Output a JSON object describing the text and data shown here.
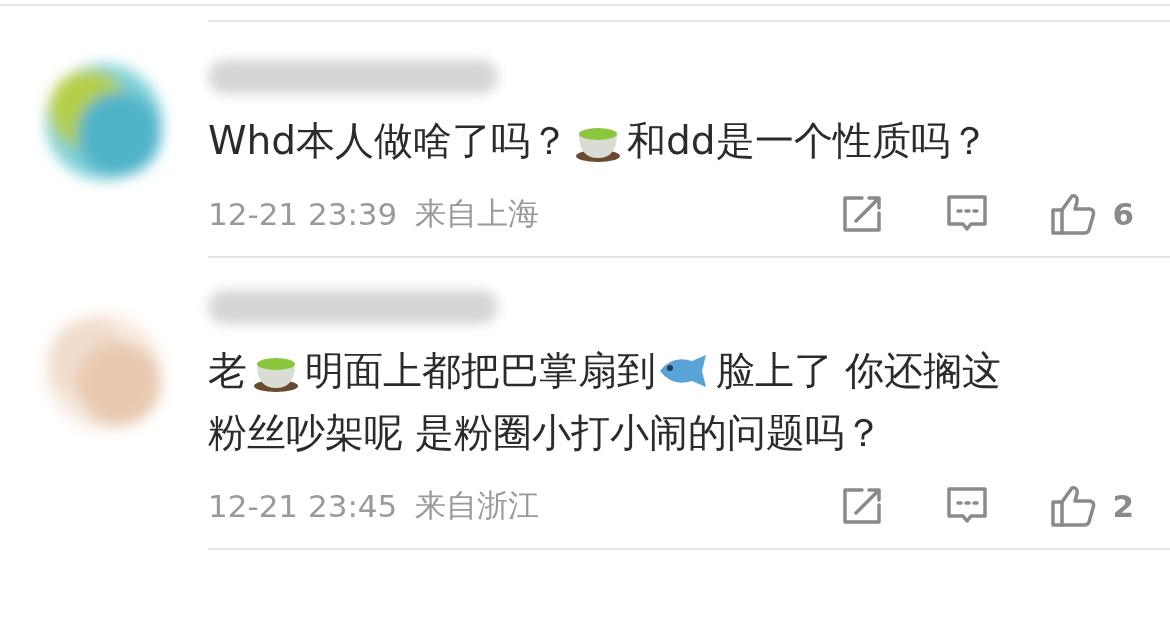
{
  "comments": [
    {
      "avatar": {
        "kind": "picture"
      },
      "lines": [
        [
          {
            "kind": "text",
            "text": "Whd本人做啥了吗？"
          },
          {
            "kind": "teacup"
          },
          {
            "kind": "text",
            "text": "和dd是一个性质吗？"
          }
        ]
      ],
      "time": "12-21 23:39",
      "location": "来自上海",
      "likes": "6"
    },
    {
      "avatar": {
        "kind": "picture"
      },
      "lines": [
        [
          {
            "kind": "text",
            "text": "老"
          },
          {
            "kind": "teacup"
          },
          {
            "kind": "text",
            "text": "明面上都把巴掌扇到"
          },
          {
            "kind": "fish"
          },
          {
            "kind": "text",
            "text": "脸上了 你还搁这"
          }
        ],
        [
          {
            "kind": "text",
            "text": "粉丝吵架呢 是粉圈小打小闹的问题吗？"
          }
        ]
      ],
      "time": "12-21 23:45",
      "location": "来自浙江",
      "likes": "2"
    }
  ]
}
